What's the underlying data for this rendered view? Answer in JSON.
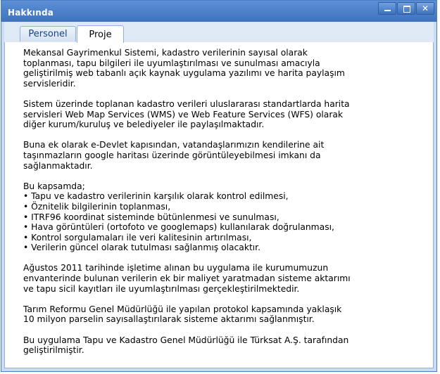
{
  "window": {
    "title": "Hakkında",
    "controls": [
      "minimize-icon",
      "maximize-icon",
      "close-icon"
    ]
  },
  "tabs": [
    {
      "label": "Personel",
      "active": false
    },
    {
      "label": "Proje",
      "active": true
    }
  ],
  "content": {
    "p1": [
      "Mekansal Gayrimenkul Sistemi, kadastro verilerinin sayısal olarak",
      "toplanması, tapu bilgileri ile uyumlaştırılması ve sunulması amacıyla",
      "geliştirilmiş web tabanlı açık kaynak uygulama yazılımı ve harita paylaşım",
      "servisleridir."
    ],
    "p2": [
      "Sistem üzerinde toplanan kadastro verileri uluslararası standartlarda harita",
      "servisleri Web Map Services (WMS) ve Web Feature Services (WFS) olarak",
      "diğer kurum/kuruluş ve belediyeler ile paylaşılmaktadır."
    ],
    "p3": [
      "Buna ek olarak e-Devlet kapısından, vatandaşlarımızın kendilerine ait",
      "taşınmazların google haritası üzerinde görüntüleyebilmesi imkanı da",
      "sağlanmaktadır."
    ],
    "p4_intro": "Bu kapsamda;",
    "p4_bullets": [
      "• Tapu ve kadastro verilerinin karşılık olarak kontrol edilmesi,",
      "• Öznitelik bilgilerinin toplanması,",
      "• ITRF96 koordinat sisteminde bütünlenmesi ve sunulması,",
      "• Hava görüntüleri (ortofoto ve googlemaps) kullanılarak doğrulanması,",
      "• Kontrol sorgulamaları ile veri kalitesinin artırılması,",
      "• Verilerin güncel olarak tutulması sağlanmış olacaktır."
    ],
    "p5": [
      "Ağustos 2011 tarihinde işletime alınan bu uygulama ile kurumumuzun",
      "envanterinde bulunan verilerin ek bir maliyet yaratmadan sisteme aktarımı",
      "ve tapu sicil kayıtları ile uyumlaştırılması gerçekleştirilmektedir."
    ],
    "p6": [
      "Tarım Reformu Genel Müdürlüğü ile yapılan protokol kapsamında yaklaşık",
      "10 milyon parselin sayısallaştırılarak sisteme aktarımı sağlanmıştır."
    ],
    "p7": [
      "Bu uygulama Tapu ve Kadastro Genel Müdürlüğü ile Türksat A.Ş. tarafından",
      "geliştirilmiştir."
    ]
  }
}
